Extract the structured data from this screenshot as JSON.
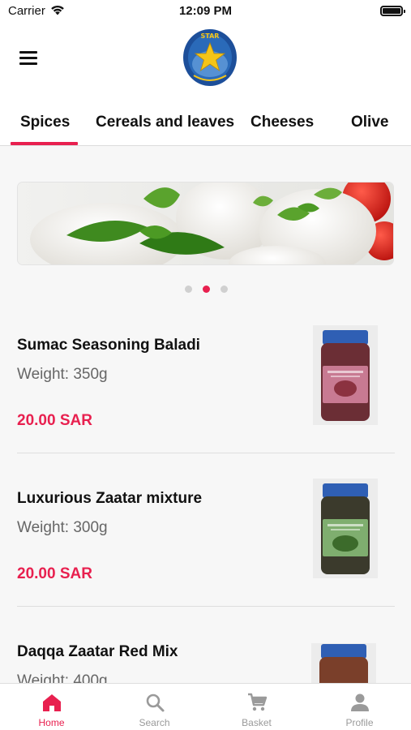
{
  "status_bar": {
    "carrier": "Carrier",
    "time": "12:09 PM"
  },
  "header": {
    "menu_icon": "hamburger-menu-icon",
    "logo_icon": "star-logo",
    "logo_text": "STAR"
  },
  "tabs": [
    {
      "label": "Spices",
      "active": true
    },
    {
      "label": "Cereals and leaves",
      "active": false
    },
    {
      "label": "Cheeses",
      "active": false
    },
    {
      "label": "Olive",
      "active": false
    }
  ],
  "banner": {
    "active_slide": 2,
    "slide_count": 3
  },
  "products": [
    {
      "name": "Sumac Seasoning Baladi",
      "weight": "Weight: 350g",
      "price": "20.00 SAR",
      "label_color": "#c87a92"
    },
    {
      "name": "Luxurious Zaatar mixture",
      "weight": "Weight: 300g",
      "price": "20.00 SAR",
      "label_color": "#7fae6f"
    },
    {
      "name": "Daqqa Zaatar Red Mix",
      "weight": "Weight: 400g",
      "price": "",
      "label_color": "#b07a5c"
    }
  ],
  "bottom_nav": [
    {
      "label": "Home",
      "icon": "home-icon",
      "active": true
    },
    {
      "label": "Search",
      "icon": "search-icon",
      "active": false
    },
    {
      "label": "Basket",
      "icon": "cart-icon",
      "active": false
    },
    {
      "label": "Profile",
      "icon": "profile-icon",
      "active": false
    }
  ],
  "colors": {
    "accent": "#e8204f",
    "inactive": "#9a9a9a",
    "logo_bg": "#1d4f9a",
    "star": "#f5c518"
  }
}
